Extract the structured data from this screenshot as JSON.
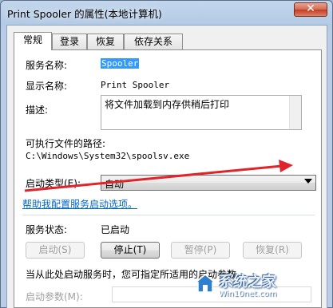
{
  "window": {
    "title": "Print Spooler 的属性(本地计算机)",
    "close_label": "✕"
  },
  "tabs": [
    "常规",
    "登录",
    "恢复",
    "依存关系"
  ],
  "general": {
    "service_name_label": "服务名称:",
    "service_name_value": "Spooler",
    "display_name_label": "显示名称:",
    "display_name_value": "Print Spooler",
    "description_label": "描述:",
    "description_value": "将文件加载到内存供稍后打印",
    "path_label": "可执行文件的路径:",
    "path_value": "C:\\Windows\\System32\\spoolsv.exe",
    "startup_type_label": "启动类型(E):",
    "startup_type_value": "自动",
    "help_link": "帮助我配置服务启动选项。",
    "status_label": "服务状态:",
    "status_value": "已启动",
    "buttons": {
      "start": "启动(S)",
      "stop": "停止(T)",
      "pause": "暂停(P)",
      "resume": "恢复(R)"
    },
    "params_hint": "当从此处启动服务时，您可指定所适用的启动参数。",
    "params_label": "启动参数(M):"
  },
  "watermark": {
    "brand": "系统之家",
    "url": "Win10net.com"
  },
  "colors": {
    "arrow": "#e0242b",
    "link": "#0066cc",
    "selection": "#3399ff"
  }
}
